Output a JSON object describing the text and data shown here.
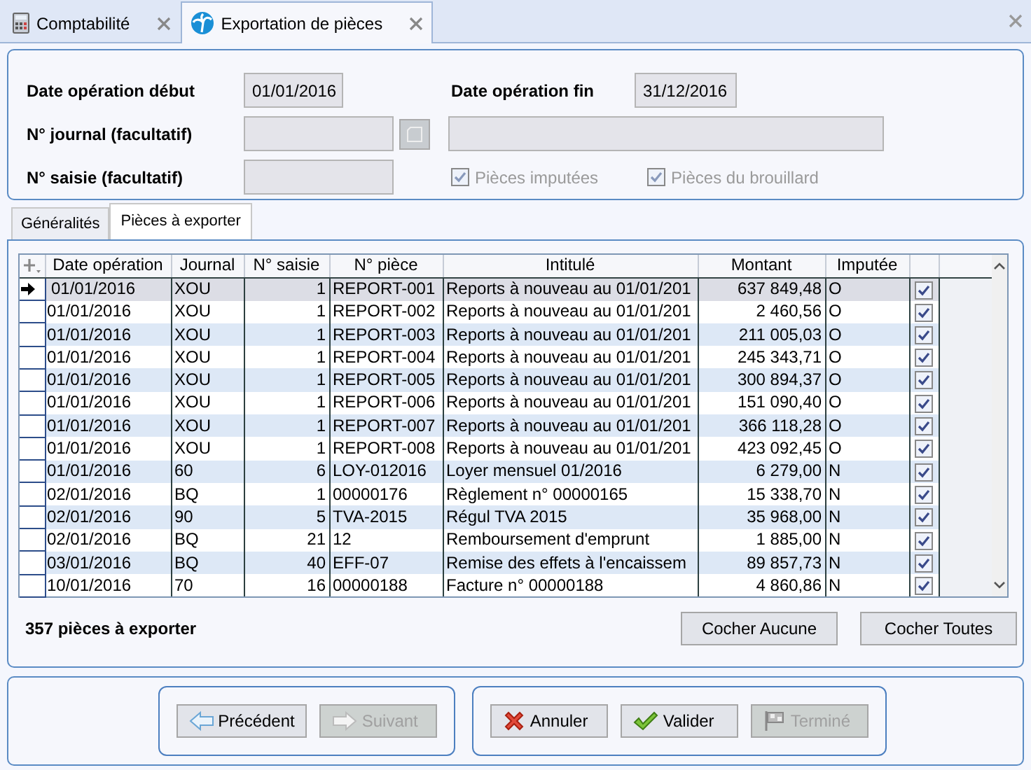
{
  "doc_tabs": [
    {
      "label": "Comptabilité",
      "selected": false
    },
    {
      "label": "Exportation de pièces",
      "selected": true
    }
  ],
  "filters": {
    "date_start": {
      "label": "Date opération début",
      "value": "01/01/2016"
    },
    "date_end": {
      "label": "Date opération fin",
      "value": "31/12/2016"
    },
    "journal": {
      "label": "N° journal (facultatif)"
    },
    "saisie": {
      "label": "N° saisie (facultatif)"
    },
    "checkboxes": [
      {
        "label": "Pièces imputées",
        "checked": true,
        "disabled": true
      },
      {
        "label": "Pièces du brouillard",
        "checked": true,
        "disabled": true
      }
    ]
  },
  "section_tabs": [
    {
      "label": "Généralités",
      "selected": false
    },
    {
      "label": "Pièces à exporter",
      "selected": true
    }
  ],
  "table": {
    "columns": [
      "Date opération",
      "Journal",
      "N° saisie",
      "N° pièce",
      "Intitulé",
      "Montant",
      "Imputée"
    ],
    "rows": [
      {
        "cells": [
          "01/01/2016",
          "XOU",
          "1",
          "REPORT-001",
          "Reports à nouveau au 01/01/201",
          "637 849,48",
          "O"
        ],
        "checked": true,
        "selected": true
      },
      {
        "cells": [
          "01/01/2016",
          "XOU",
          "1",
          "REPORT-002",
          "Reports à nouveau au 01/01/201",
          "2 460,56",
          "O"
        ],
        "checked": true,
        "selected": false
      },
      {
        "cells": [
          "01/01/2016",
          "XOU",
          "1",
          "REPORT-003",
          "Reports à nouveau au 01/01/201",
          "211 005,03",
          "O"
        ],
        "checked": true,
        "selected": false
      },
      {
        "cells": [
          "01/01/2016",
          "XOU",
          "1",
          "REPORT-004",
          "Reports à nouveau au 01/01/201",
          "245 343,71",
          "O"
        ],
        "checked": true,
        "selected": false
      },
      {
        "cells": [
          "01/01/2016",
          "XOU",
          "1",
          "REPORT-005",
          "Reports à nouveau au 01/01/201",
          "300 894,37",
          "O"
        ],
        "checked": true,
        "selected": false
      },
      {
        "cells": [
          "01/01/2016",
          "XOU",
          "1",
          "REPORT-006",
          "Reports à nouveau au 01/01/201",
          "151 090,40",
          "O"
        ],
        "checked": true,
        "selected": false
      },
      {
        "cells": [
          "01/01/2016",
          "XOU",
          "1",
          "REPORT-007",
          "Reports à nouveau au 01/01/201",
          "366 118,28",
          "O"
        ],
        "checked": true,
        "selected": false
      },
      {
        "cells": [
          "01/01/2016",
          "XOU",
          "1",
          "REPORT-008",
          "Reports à nouveau au 01/01/201",
          "423 092,45",
          "O"
        ],
        "checked": true,
        "selected": false
      },
      {
        "cells": [
          "01/01/2016",
          "60",
          "6",
          "LOY-012016",
          "Loyer mensuel 01/2016",
          "6 279,00",
          "N"
        ],
        "checked": true,
        "selected": false
      },
      {
        "cells": [
          "02/01/2016",
          "BQ",
          "1",
          "00000176",
          "Règlement n° 00000165",
          "15 338,70",
          "N"
        ],
        "checked": true,
        "selected": false
      },
      {
        "cells": [
          "02/01/2016",
          "90",
          "5",
          "TVA-2015",
          "Régul TVA 2015",
          "35 968,00",
          "N"
        ],
        "checked": true,
        "selected": false
      },
      {
        "cells": [
          "02/01/2016",
          "BQ",
          "21",
          "12",
          "Remboursement d'emprunt",
          "1 885,00",
          "N"
        ],
        "checked": true,
        "selected": false
      },
      {
        "cells": [
          "03/01/2016",
          "BQ",
          "40",
          "EFF-07",
          "Remise des effets à l'encaissem",
          "89 857,73",
          "N"
        ],
        "checked": true,
        "selected": false
      },
      {
        "cells": [
          "10/01/2016",
          "70",
          "16",
          "00000188",
          "Facture n° 00000188",
          "4 860,86",
          "N"
        ],
        "checked": true,
        "selected": false
      }
    ]
  },
  "count": "357 pièces à exporter",
  "select_buttons": [
    "Cocher Aucune",
    "Cocher Toutes"
  ],
  "nav_buttons": [
    {
      "label": "Précédent",
      "disabled": false
    },
    {
      "label": "Suivant",
      "disabled": true
    }
  ],
  "action_buttons": [
    {
      "label": "Annuler",
      "disabled": false
    },
    {
      "label": "Valider",
      "disabled": false
    },
    {
      "label": "Terminé",
      "disabled": true
    }
  ]
}
